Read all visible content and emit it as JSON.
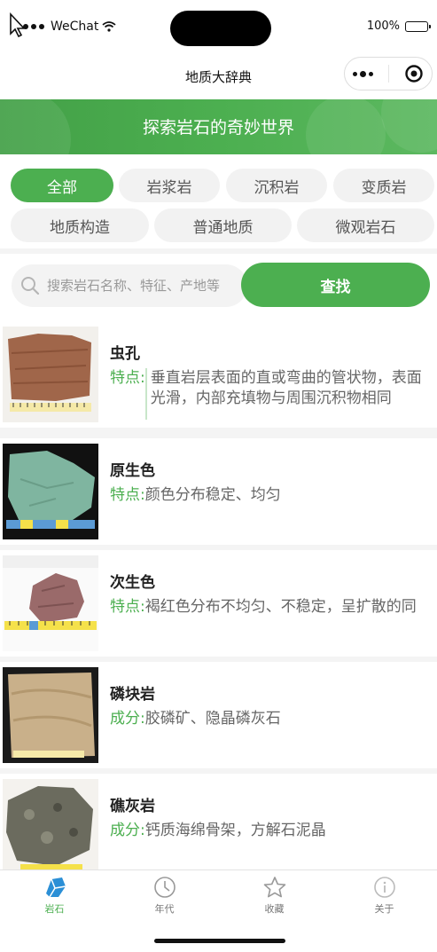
{
  "status_bar": {
    "carrier": "WeChat",
    "battery": "100%"
  },
  "nav": {
    "title": "地质大辞典"
  },
  "banner": {
    "text": "探索岩石的奇妙世界"
  },
  "categories": [
    "全部",
    "岩浆岩",
    "沉积岩",
    "变质岩",
    "地质构造",
    "普通地质",
    "微观岩石"
  ],
  "search": {
    "placeholder": "搜索岩石名称、特征、产地等",
    "button": "查找"
  },
  "items": [
    {
      "title": "虫孔",
      "label": "特点:",
      "value": "垂直岩层表面的直或弯曲的管状物，表面光滑，内部充填物与周围沉积物相同",
      "thumb_color": "#a0664a"
    },
    {
      "title": "原生色",
      "label": "特点:",
      "value": "颜色分布稳定、均匀",
      "thumb_color": "#7fb5a0"
    },
    {
      "title": "次生色",
      "label": "特点:",
      "value": "褐红色分布不均匀、不稳定，呈扩散的同心圆状",
      "thumb_color": "#9a6a6a"
    },
    {
      "title": "磷块岩",
      "label": "成分:",
      "value": "胶磷矿、隐晶磷灰石",
      "thumb_color": "#c9b08a"
    },
    {
      "title": "礁灰岩",
      "label": "成分:",
      "value": "钙质海绵骨架，方解石泥晶",
      "thumb_color": "#6b6b5e"
    }
  ],
  "tabs": [
    {
      "label": "岩石",
      "icon": "rock-icon"
    },
    {
      "label": "年代",
      "icon": "clock-icon"
    },
    {
      "label": "收藏",
      "icon": "star-icon"
    },
    {
      "label": "关于",
      "icon": "info-icon"
    }
  ],
  "colors": {
    "accent": "#4caf50"
  }
}
